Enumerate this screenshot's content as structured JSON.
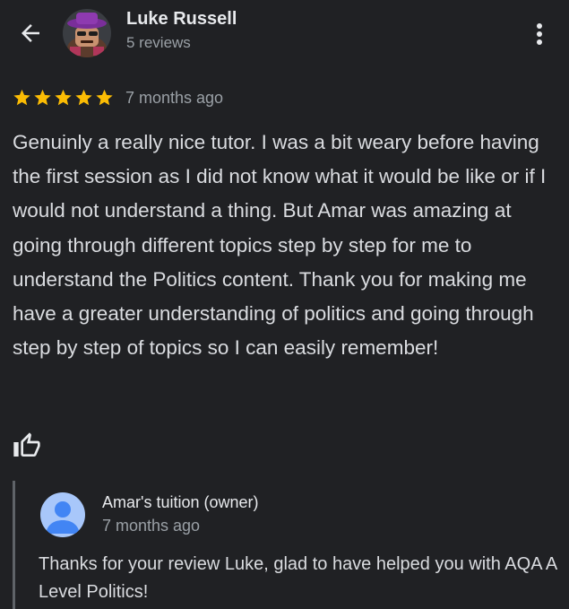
{
  "reviewer": {
    "name": "Luke Russell",
    "review_count": "5 reviews"
  },
  "review": {
    "rating": 5,
    "rating_max": 5,
    "date": "7 months ago",
    "text": "Genuinly a really nice tutor. I was a bit weary before having the first session as I did not know what it would be like or if I would not understand a thing. But Amar was amazing at going through different topics step by step for me to understand the Politics content. Thank you for making me have a greater understanding of politics and going through step by step of topics so I can easily remember!"
  },
  "owner_reply": {
    "name": "Amar's tuition (owner)",
    "date": "7 months ago",
    "text": "Thanks for your review Luke, glad to have helped you with AQA A Level Politics!"
  },
  "icons": {
    "back": "arrow-back-icon",
    "more": "more-vert-icon",
    "star": "star-icon",
    "like": "thumb-up-icon",
    "owner_avatar": "person-icon"
  },
  "colors": {
    "background": "#202124",
    "star": "#fbbc04",
    "text_primary": "#e8eaed",
    "text_secondary": "#9aa0a6",
    "reply_border": "#5f6368",
    "owner_avatar_bg": "#a8c7fa",
    "owner_avatar_fg": "#4285f4"
  }
}
